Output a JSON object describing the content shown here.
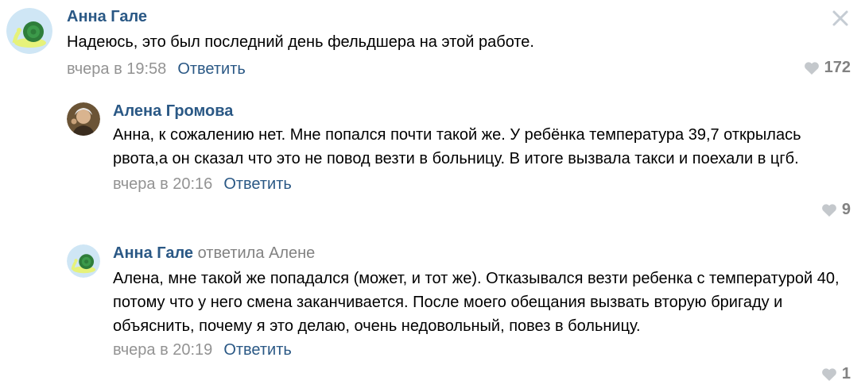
{
  "comments": [
    {
      "author": "Анна Гале",
      "reply_to": "",
      "text": "Надеюсь, это был последний день фельдшера на этой работе.",
      "date": "вчера в 19:58",
      "reply_label": "Ответить",
      "likes": "172"
    },
    {
      "author": "Алена Громова",
      "reply_to": "",
      "text": "Анна, к сожалению нет. Мне попался почти такой же. У ребёнка температура 39,7 открылась рвота,а он сказал что это не повод везти в больницу. В итоге вызвала такси и поехали в цгб.",
      "date": "вчера в 20:16",
      "reply_label": "Ответить",
      "likes": "9"
    },
    {
      "author": "Анна Гале",
      "reply_to": "ответила Алене",
      "text": "Алена, мне такой же попадался (может, и тот же). Отказывался везти ребенка с температурой 40, потому что у него смена заканчивается. После моего обещания вызвать вторую бригаду и объяснить, почему я это делаю, очень недовольный, повез в больницу.",
      "date": "вчера в 20:19",
      "reply_label": "Ответить",
      "likes": "1"
    }
  ],
  "icons": {
    "close": "close-icon",
    "like": "heart-icon",
    "avatar_snail": "snail-avatar-icon",
    "avatar_person": "person-avatar-icon"
  },
  "colors": {
    "author": "#2a5885",
    "link": "#2a5885",
    "meta": "#939393",
    "like": "#c4c8cc"
  }
}
